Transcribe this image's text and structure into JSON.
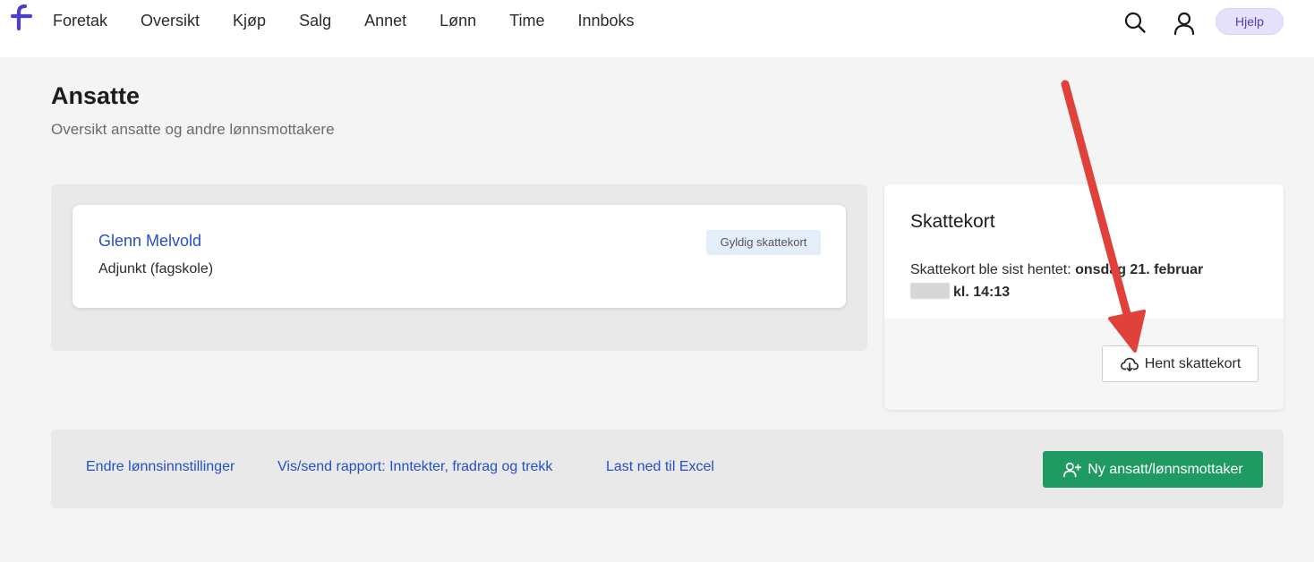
{
  "nav": {
    "items": [
      {
        "label": "Foretak"
      },
      {
        "label": "Oversikt"
      },
      {
        "label": "Kjøp"
      },
      {
        "label": "Salg"
      },
      {
        "label": "Annet"
      },
      {
        "label": "Lønn"
      },
      {
        "label": "Time"
      },
      {
        "label": "Innboks"
      }
    ],
    "help_label": "Hjelp",
    "logo_icon": "fiken-f-logo",
    "search_icon": "search-icon",
    "user_icon": "user-icon"
  },
  "page": {
    "title": "Ansatte",
    "subtitle": "Oversikt ansatte og andre lønnsmottakere"
  },
  "employees": [
    {
      "name": "Glenn Melvold",
      "role": "Adjunkt (fagskole)",
      "badge": "Gyldig skattekort"
    }
  ],
  "tax_card": {
    "title": "Skattekort",
    "info_prefix": "Skattekort ble sist hentet: ",
    "info_date": "onsdag 21. februar",
    "info_time": "kl. 14:13",
    "fetch_label": "Hent skattekort",
    "fetch_icon": "cloud-download-icon"
  },
  "actions": {
    "links": [
      {
        "label": "Endre lønnsinnstillinger"
      },
      {
        "label": "Vis/send rapport: Inntekter, fradrag og trekk"
      },
      {
        "label": "Last ned til Excel"
      }
    ],
    "primary_label": "Ny ansatt/lønnsmottaker",
    "primary_icon": "add-user-icon"
  },
  "colors": {
    "accent_link": "#2450c8",
    "primary_green": "#1f9a63",
    "help_purple": "#e6e2fb",
    "annotation_red": "#e0413a"
  }
}
